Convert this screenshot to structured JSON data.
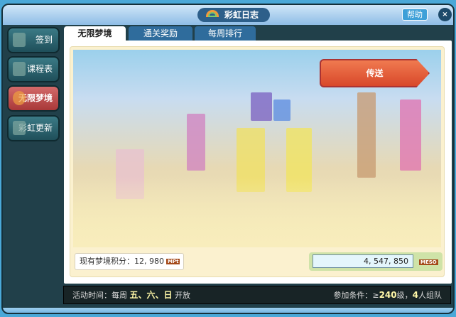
{
  "window": {
    "title": "彩虹日志",
    "help_label": "帮助",
    "close_label": "×"
  },
  "sidebar": {
    "items": [
      {
        "label": "签到"
      },
      {
        "label": "课程表"
      },
      {
        "label": "无限梦境"
      },
      {
        "label": "彩虹更新"
      }
    ]
  },
  "tabs": [
    {
      "label": "无限梦境"
    },
    {
      "label": "通关奖励"
    },
    {
      "label": "每周排行"
    }
  ],
  "main": {
    "teleport_label": "传送",
    "score_label": "现有梦境积分：12, 980",
    "score_unit": "MPt",
    "meso_value": "4, 547, 850",
    "meso_unit": "MESO"
  },
  "footer": {
    "time_label": "活动时间：每周",
    "days": "五、六、日",
    "open": "开放",
    "cond_label": "参加条件：≥",
    "level": "240",
    "level_suffix": "级，",
    "party": "4",
    "party_suffix": "人组队"
  },
  "colors": {
    "accent": "#2f6c9c",
    "active": "#b84444",
    "teleport": "#e05a34"
  }
}
